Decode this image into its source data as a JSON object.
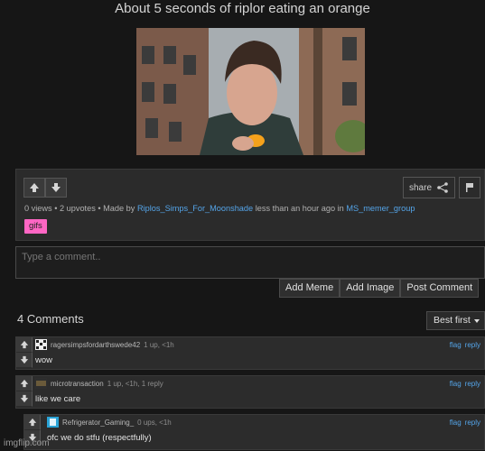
{
  "post": {
    "title": "About 5 seconds of riplor eating an orange",
    "views": "0 views",
    "upvotes": "2 upvotes",
    "made_by_prefix": "Made by",
    "author": "Riplos_Simps_For_Moonshade",
    "time_text": "less than an hour ago in",
    "stream": "MS_memer_group",
    "tag": "gifs",
    "share_label": "share"
  },
  "composer": {
    "placeholder": "Type a comment..",
    "buttons": [
      "Add Meme",
      "Add Image",
      "Post Comment"
    ]
  },
  "comments_header": {
    "count_label": "4 Comments",
    "sort_label": "Best first"
  },
  "comments": [
    {
      "user": "ragersimpsfordarthswede42",
      "stats": "1 up, <1h",
      "text": "wow",
      "links": [
        "flag",
        "reply"
      ]
    },
    {
      "user": "microtransaction",
      "stats": "1 up, <1h, 1 reply",
      "text": "like we care",
      "links": [
        "flag",
        "reply"
      ]
    },
    {
      "user": "Refrigerator_Gaming_",
      "stats": "0 ups, <1h",
      "text": "ofc we do stfu (respectfully)",
      "links": [
        "flag",
        "reply"
      ]
    }
  ],
  "watermark": "imgflip.com",
  "colors": {
    "link": "#54a4e8",
    "tag": "#ff66c4",
    "reply_bar": "#f28c28"
  }
}
